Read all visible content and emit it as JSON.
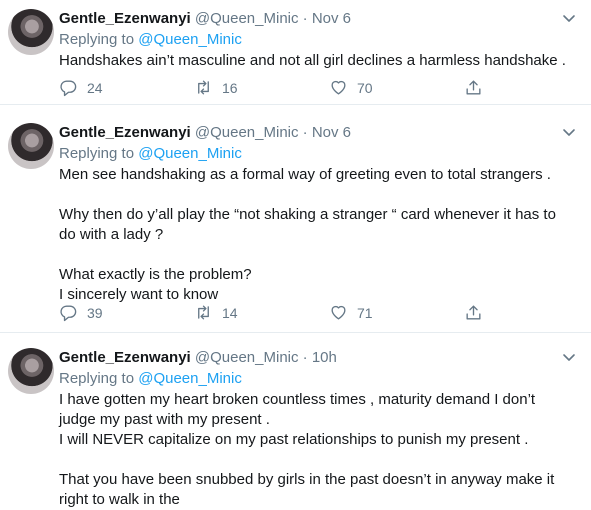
{
  "tweets": [
    {
      "name": "Gentle_Ezenwanyi",
      "handle": "@Queen_Minic",
      "separator": "·",
      "time": "Nov 6",
      "replying_prefix": "Replying to",
      "replying_to": "@Queen_Minic",
      "lines": [
        "Handshakes ain’t masculine and not all girl declines a harmless handshake ."
      ],
      "replies": "24",
      "retweets": "16",
      "likes": "70"
    },
    {
      "name": "Gentle_Ezenwanyi",
      "handle": "@Queen_Minic",
      "separator": "·",
      "time": "Nov 6",
      "replying_prefix": "Replying to",
      "replying_to": "@Queen_Minic",
      "lines": [
        "Men see handshaking as a formal way of greeting even to total strangers .",
        "",
        "Why then do y’all play the “not shaking a stranger “ card whenever it has to",
        "do with a lady ?",
        "",
        "What exactly is the problem?",
        "I sincerely want to know"
      ],
      "replies": "39",
      "retweets": "14",
      "likes": "71"
    },
    {
      "name": "Gentle_Ezenwanyi",
      "handle": "@Queen_Minic",
      "separator": "·",
      "time": "10h",
      "replying_prefix": "Replying to",
      "replying_to": "@Queen_Minic",
      "lines": [
        "I have gotten my heart broken countless times , maturity demand I don’t",
        "judge my past with my present .",
        "I will NEVER capitalize on my past relationships to punish my present .",
        "",
        "That you have been snubbed by girls in the past doesn’t in anyway make it",
        "right to walk in the"
      ]
    }
  ],
  "icons": {
    "reply": "reply-icon",
    "retweet": "retweet-icon",
    "like": "heart-icon",
    "share": "share-icon",
    "menu": "chevron-down-icon",
    "avatar": "avatar"
  },
  "colors": {
    "text": "#14171a",
    "muted": "#657786",
    "link": "#1da1f2",
    "divider": "#e6ecf0"
  }
}
